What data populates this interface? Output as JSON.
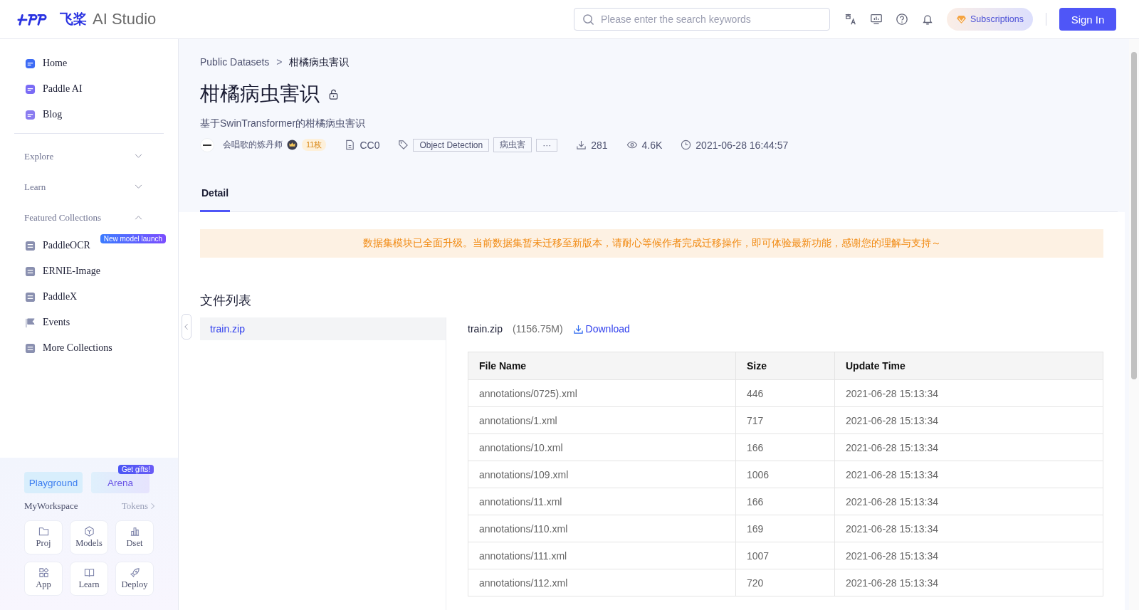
{
  "header": {
    "logo_cn": "飞桨",
    "logo_en": "AI Studio",
    "search": {
      "placeholder": "Please enter the search keywords"
    },
    "subscriptions": "Subscriptions",
    "sign_in": "Sign In"
  },
  "sidebar": {
    "items": [
      {
        "label": "Home"
      },
      {
        "label": "Paddle AI"
      },
      {
        "label": "Blog"
      }
    ],
    "sections": [
      {
        "label": "Explore",
        "expanded": false
      },
      {
        "label": "Learn",
        "expanded": false
      },
      {
        "label": "Featured Collections",
        "expanded": true,
        "items": [
          {
            "label": "PaddleOCR",
            "badge": "New model launch"
          },
          {
            "label": "ERNIE-Image"
          },
          {
            "label": "PaddleX"
          },
          {
            "label": "Events"
          },
          {
            "label": "More Collections"
          }
        ]
      }
    ],
    "workspace": {
      "playground": "Playground",
      "arena": "Arena",
      "arena_badge": "Get gifts!",
      "title": "MyWorkspace",
      "tokens": "Tokens",
      "tiles": [
        {
          "label": "Proj"
        },
        {
          "label": "Models"
        },
        {
          "label": "Dset"
        },
        {
          "label": "App"
        },
        {
          "label": "Learn"
        },
        {
          "label": "Deploy"
        }
      ]
    }
  },
  "breadcrumb": [
    {
      "label": "Public Datasets"
    },
    {
      "label": "柑橘病虫害识"
    }
  ],
  "breadcrumb_separator": ">",
  "title": "柑橘病虫害识",
  "subtitle": "基于SwinTransformer的柑橘病虫害识",
  "meta": {
    "author": "会唱歌的炼丹师",
    "coins": "11枚",
    "license": "CC0",
    "tags": [
      "Object Detection",
      "病虫害",
      "···"
    ],
    "downloads": "281",
    "views": "4.6K",
    "date": "2021-06-28 16:44:57"
  },
  "tabs": [
    {
      "label": "Detail",
      "selected": true
    }
  ],
  "notice": "数据集模块已全面升级。当前数据集暂未迁移至新版本，请耐心等候作者完成迁移操作，即可体验最新功能，感谢您的理解与支持～",
  "files_title": "文件列表",
  "files": [
    {
      "name": "train.zip",
      "selected": true
    }
  ],
  "file_detail": {
    "name": "train.zip",
    "size": "(1156.75M)",
    "download": "Download"
  },
  "table": {
    "columns": [
      "File Name",
      "Size",
      "Update Time"
    ],
    "rows": [
      [
        "annotations/0725).xml",
        "446",
        "2021-06-28 15:13:34"
      ],
      [
        "annotations/1.xml",
        "717",
        "2021-06-28 15:13:34"
      ],
      [
        "annotations/10.xml",
        "166",
        "2021-06-28 15:13:34"
      ],
      [
        "annotations/109.xml",
        "1006",
        "2021-06-28 15:13:34"
      ],
      [
        "annotations/11.xml",
        "166",
        "2021-06-28 15:13:34"
      ],
      [
        "annotations/110.xml",
        "169",
        "2021-06-28 15:13:34"
      ],
      [
        "annotations/111.xml",
        "1007",
        "2021-06-28 15:13:34"
      ],
      [
        "annotations/112.xml",
        "720",
        "2021-06-28 15:13:34"
      ]
    ]
  }
}
